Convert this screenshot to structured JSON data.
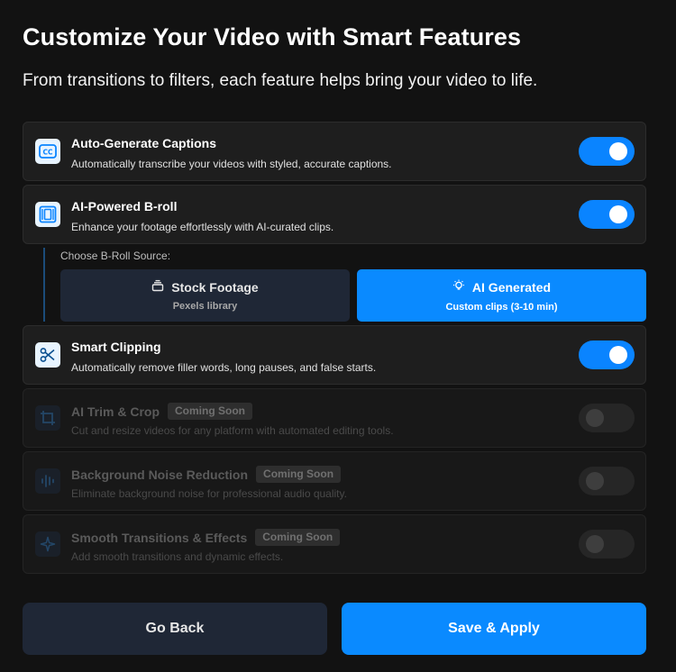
{
  "header": {
    "title": "Customize Your Video with Smart Features",
    "subtitle": "From transitions to filters, each feature helps bring your video to life."
  },
  "features": [
    {
      "title": "Auto-Generate Captions",
      "description": "Automatically transcribe your videos with styled, accurate captions.",
      "icon": "captions-icon",
      "enabled": true
    },
    {
      "title": "AI-Powered B-roll",
      "description": "Enhance your footage effortlessly with AI-curated clips.",
      "icon": "film-icon",
      "enabled": true
    },
    {
      "title": "Smart Clipping",
      "description": "Automatically remove filler words, long pauses, and false starts.",
      "icon": "scissors-icon",
      "enabled": true
    },
    {
      "title": "AI Trim & Crop",
      "badge": "Coming Soon",
      "description": "Cut and resize videos for any platform with automated editing tools.",
      "icon": "crop-icon",
      "enabled": false
    },
    {
      "title": "Background Noise Reduction",
      "badge": "Coming Soon",
      "description": "Eliminate background noise for professional audio quality.",
      "icon": "audio-wave-icon",
      "enabled": false
    },
    {
      "title": "Smooth Transitions & Effects",
      "badge": "Coming Soon",
      "description": "Add smooth transitions and dynamic effects.",
      "icon": "sparkle-icon",
      "enabled": false
    }
  ],
  "broll_source": {
    "label": "Choose B-Roll Source:",
    "options": [
      {
        "title": "Stock Footage",
        "subtitle": "Pexels library",
        "icon": "stack-icon",
        "selected": false
      },
      {
        "title": "AI Generated",
        "subtitle": "Custom clips (3-10 min)",
        "icon": "lightbulb-icon",
        "selected": true
      }
    ]
  },
  "actions": {
    "back_label": "Go Back",
    "save_label": "Save & Apply"
  },
  "colors": {
    "accent": "#0a8aff",
    "background": "#121212",
    "card": "#1e1e1e"
  }
}
